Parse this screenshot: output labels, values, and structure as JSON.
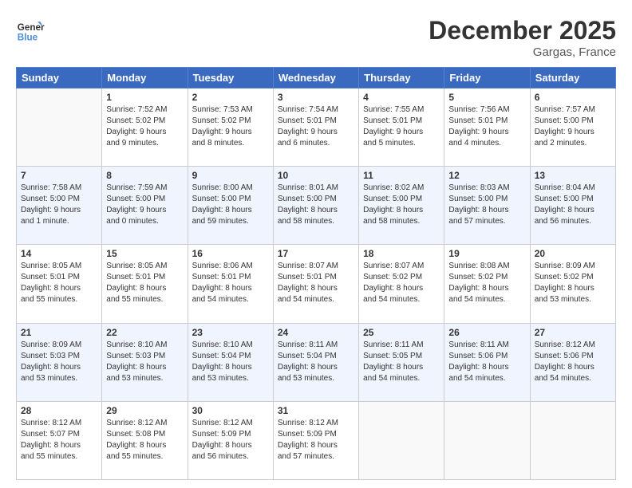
{
  "logo": {
    "line1": "General",
    "line2": "Blue"
  },
  "title": "December 2025",
  "subtitle": "Gargas, France",
  "weekdays": [
    "Sunday",
    "Monday",
    "Tuesday",
    "Wednesday",
    "Thursday",
    "Friday",
    "Saturday"
  ],
  "weeks": [
    [
      {
        "day": "",
        "info": ""
      },
      {
        "day": "1",
        "info": "Sunrise: 7:52 AM\nSunset: 5:02 PM\nDaylight: 9 hours\nand 9 minutes."
      },
      {
        "day": "2",
        "info": "Sunrise: 7:53 AM\nSunset: 5:02 PM\nDaylight: 9 hours\nand 8 minutes."
      },
      {
        "day": "3",
        "info": "Sunrise: 7:54 AM\nSunset: 5:01 PM\nDaylight: 9 hours\nand 6 minutes."
      },
      {
        "day": "4",
        "info": "Sunrise: 7:55 AM\nSunset: 5:01 PM\nDaylight: 9 hours\nand 5 minutes."
      },
      {
        "day": "5",
        "info": "Sunrise: 7:56 AM\nSunset: 5:01 PM\nDaylight: 9 hours\nand 4 minutes."
      },
      {
        "day": "6",
        "info": "Sunrise: 7:57 AM\nSunset: 5:00 PM\nDaylight: 9 hours\nand 2 minutes."
      }
    ],
    [
      {
        "day": "7",
        "info": "Sunrise: 7:58 AM\nSunset: 5:00 PM\nDaylight: 9 hours\nand 1 minute."
      },
      {
        "day": "8",
        "info": "Sunrise: 7:59 AM\nSunset: 5:00 PM\nDaylight: 9 hours\nand 0 minutes."
      },
      {
        "day": "9",
        "info": "Sunrise: 8:00 AM\nSunset: 5:00 PM\nDaylight: 8 hours\nand 59 minutes."
      },
      {
        "day": "10",
        "info": "Sunrise: 8:01 AM\nSunset: 5:00 PM\nDaylight: 8 hours\nand 58 minutes."
      },
      {
        "day": "11",
        "info": "Sunrise: 8:02 AM\nSunset: 5:00 PM\nDaylight: 8 hours\nand 58 minutes."
      },
      {
        "day": "12",
        "info": "Sunrise: 8:03 AM\nSunset: 5:00 PM\nDaylight: 8 hours\nand 57 minutes."
      },
      {
        "day": "13",
        "info": "Sunrise: 8:04 AM\nSunset: 5:00 PM\nDaylight: 8 hours\nand 56 minutes."
      }
    ],
    [
      {
        "day": "14",
        "info": "Sunrise: 8:05 AM\nSunset: 5:01 PM\nDaylight: 8 hours\nand 55 minutes."
      },
      {
        "day": "15",
        "info": "Sunrise: 8:05 AM\nSunset: 5:01 PM\nDaylight: 8 hours\nand 55 minutes."
      },
      {
        "day": "16",
        "info": "Sunrise: 8:06 AM\nSunset: 5:01 PM\nDaylight: 8 hours\nand 54 minutes."
      },
      {
        "day": "17",
        "info": "Sunrise: 8:07 AM\nSunset: 5:01 PM\nDaylight: 8 hours\nand 54 minutes."
      },
      {
        "day": "18",
        "info": "Sunrise: 8:07 AM\nSunset: 5:02 PM\nDaylight: 8 hours\nand 54 minutes."
      },
      {
        "day": "19",
        "info": "Sunrise: 8:08 AM\nSunset: 5:02 PM\nDaylight: 8 hours\nand 54 minutes."
      },
      {
        "day": "20",
        "info": "Sunrise: 8:09 AM\nSunset: 5:02 PM\nDaylight: 8 hours\nand 53 minutes."
      }
    ],
    [
      {
        "day": "21",
        "info": "Sunrise: 8:09 AM\nSunset: 5:03 PM\nDaylight: 8 hours\nand 53 minutes."
      },
      {
        "day": "22",
        "info": "Sunrise: 8:10 AM\nSunset: 5:03 PM\nDaylight: 8 hours\nand 53 minutes."
      },
      {
        "day": "23",
        "info": "Sunrise: 8:10 AM\nSunset: 5:04 PM\nDaylight: 8 hours\nand 53 minutes."
      },
      {
        "day": "24",
        "info": "Sunrise: 8:11 AM\nSunset: 5:04 PM\nDaylight: 8 hours\nand 53 minutes."
      },
      {
        "day": "25",
        "info": "Sunrise: 8:11 AM\nSunset: 5:05 PM\nDaylight: 8 hours\nand 54 minutes."
      },
      {
        "day": "26",
        "info": "Sunrise: 8:11 AM\nSunset: 5:06 PM\nDaylight: 8 hours\nand 54 minutes."
      },
      {
        "day": "27",
        "info": "Sunrise: 8:12 AM\nSunset: 5:06 PM\nDaylight: 8 hours\nand 54 minutes."
      }
    ],
    [
      {
        "day": "28",
        "info": "Sunrise: 8:12 AM\nSunset: 5:07 PM\nDaylight: 8 hours\nand 55 minutes."
      },
      {
        "day": "29",
        "info": "Sunrise: 8:12 AM\nSunset: 5:08 PM\nDaylight: 8 hours\nand 55 minutes."
      },
      {
        "day": "30",
        "info": "Sunrise: 8:12 AM\nSunset: 5:09 PM\nDaylight: 8 hours\nand 56 minutes."
      },
      {
        "day": "31",
        "info": "Sunrise: 8:12 AM\nSunset: 5:09 PM\nDaylight: 8 hours\nand 57 minutes."
      },
      {
        "day": "",
        "info": ""
      },
      {
        "day": "",
        "info": ""
      },
      {
        "day": "",
        "info": ""
      }
    ]
  ]
}
